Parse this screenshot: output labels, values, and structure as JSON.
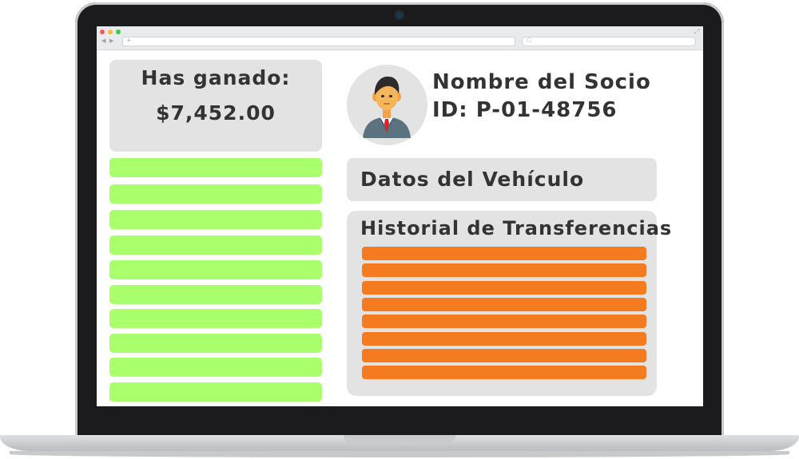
{
  "dashboard": {
    "earnings": {
      "label": "Has ganado:",
      "amount": "$7,452.00"
    },
    "member": {
      "name": "Nombre del Socio",
      "id": "ID: P-01-48756"
    },
    "vehicle": {
      "title": "Datos del Vehículo"
    },
    "history": {
      "title": "Historial de Transferencias"
    }
  },
  "icons": {
    "avatar": "businessman-avatar-icon",
    "search": "search-icon",
    "new_tab": "plus-icon",
    "expand": "expand-icon"
  },
  "colors": {
    "card_bg": "#e3e3e3",
    "text": "#333333",
    "green_bar": "#a9ff6c",
    "orange_bar": "#f47b20",
    "bezel": "#1b1b1d"
  }
}
